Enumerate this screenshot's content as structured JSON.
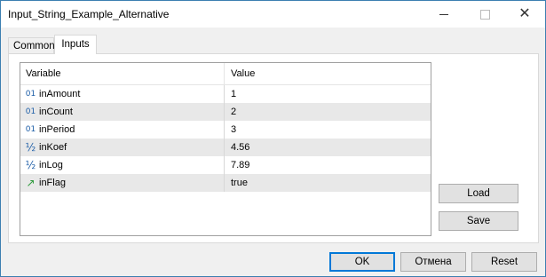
{
  "window": {
    "title": "Input_String_Example_Alternative",
    "icons": [
      "minimize-icon",
      "maximize-icon",
      "close-icon"
    ]
  },
  "tabs": [
    {
      "label": "Common",
      "active": false
    },
    {
      "label": "Inputs",
      "active": true
    }
  ],
  "grid": {
    "headers": {
      "variable": "Variable",
      "value": "Value"
    },
    "rows": [
      {
        "icon": "integer-icon",
        "glyph": "01",
        "name": "inAmount",
        "value": "1"
      },
      {
        "icon": "integer-icon",
        "glyph": "01",
        "name": "inCount",
        "value": "2"
      },
      {
        "icon": "integer-icon",
        "glyph": "01",
        "name": "inPeriod",
        "value": "3"
      },
      {
        "icon": "fraction-icon",
        "glyph": "½",
        "name": "inKoef",
        "value": "4.56"
      },
      {
        "icon": "fraction-icon",
        "glyph": "½",
        "name": "inLog",
        "value": "7.89"
      },
      {
        "icon": "bool-flag-icon",
        "glyph": "↗",
        "name": "inFlag",
        "value": "true"
      }
    ]
  },
  "side_buttons": {
    "load": "Load",
    "save": "Save"
  },
  "buttons": {
    "ok": "OK",
    "cancel": "Отмена",
    "reset": "Reset"
  },
  "colors": {
    "accent": "#0078d7",
    "int_icon": "#1f5fa8",
    "flag_icon": "#2b9a3a"
  }
}
